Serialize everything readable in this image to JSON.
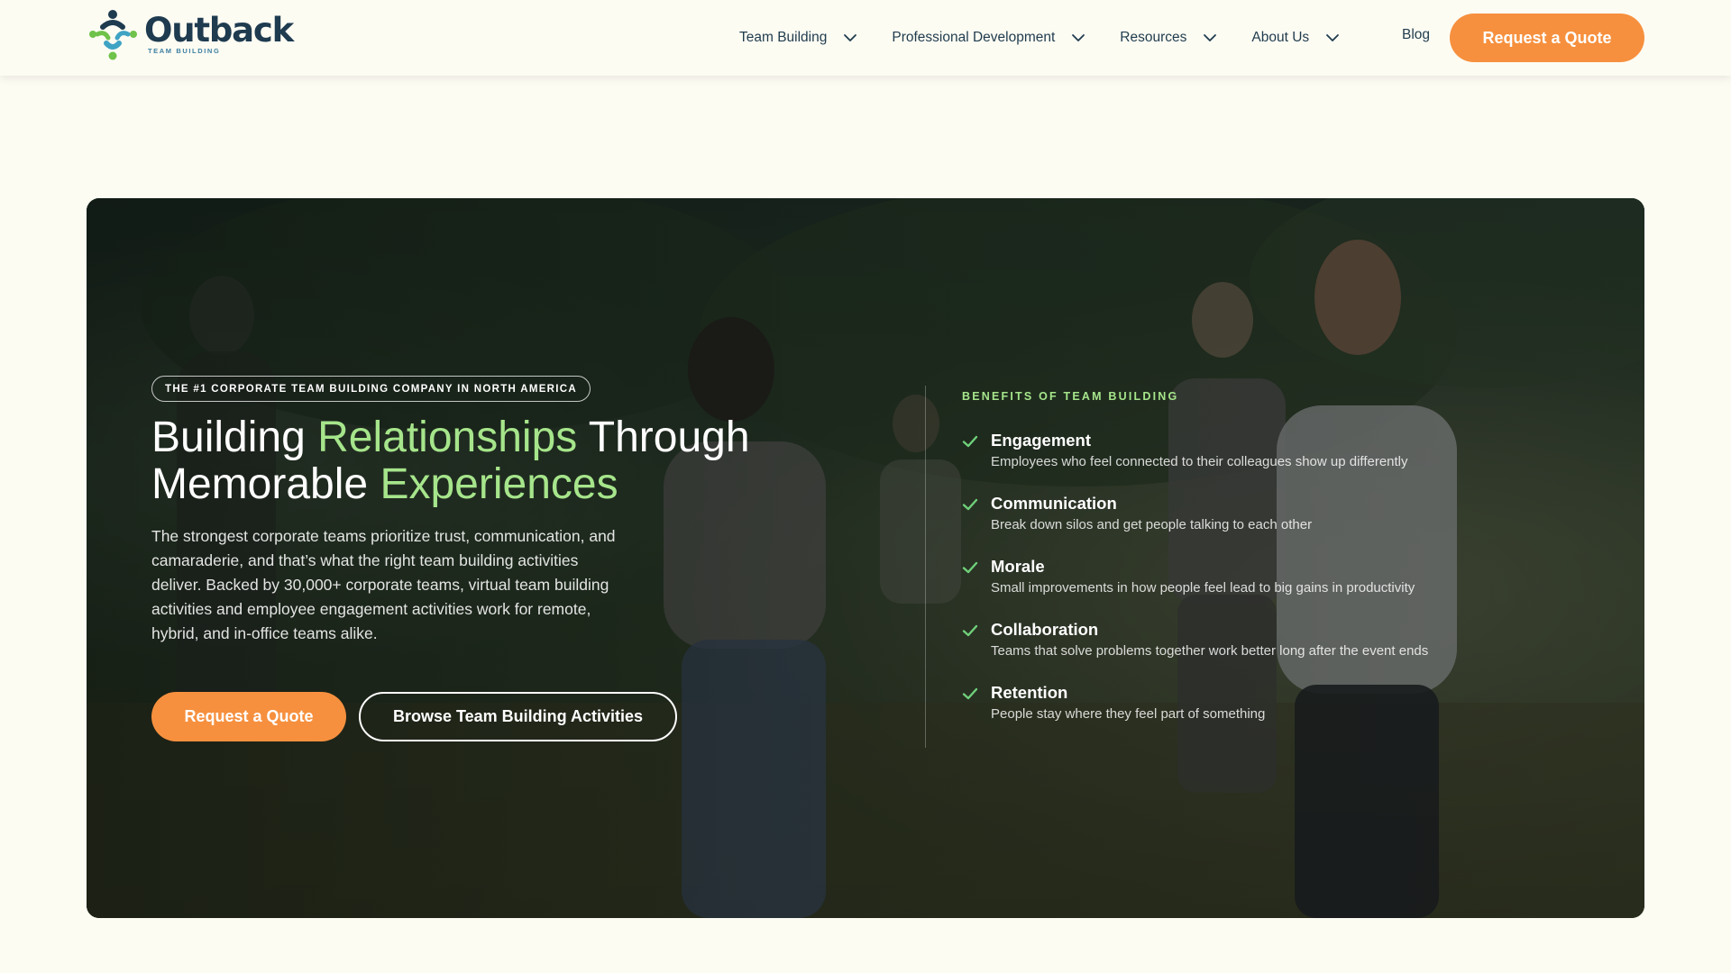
{
  "header": {
    "logo": {
      "word": "Outback",
      "sub": "TEAM BUILDING"
    },
    "nav": [
      {
        "label": "Team Building",
        "has_dropdown": true
      },
      {
        "label": "Professional Development",
        "has_dropdown": true
      },
      {
        "label": "Resources",
        "has_dropdown": true
      },
      {
        "label": "About Us",
        "has_dropdown": true
      }
    ],
    "blog_label": "Blog",
    "cta_label": "Request a Quote"
  },
  "hero": {
    "tagline": "THE #1 CORPORATE TEAM BUILDING COMPANY IN NORTH AMERICA",
    "title": {
      "part1": "Building ",
      "highlight1": "Relationships",
      "part2": " Through Memorable ",
      "highlight2": "Experiences"
    },
    "description": "The strongest corporate teams prioritize trust, communication, and camaraderie, and that’s what the right team building activities deliver. Backed by 30,000+ corporate teams, virtual team building activities and employee engagement activities work for remote, hybrid, and in-office teams alike.",
    "primary_button": "Request a Quote",
    "secondary_button": "Browse Team Building Activities"
  },
  "benefits": {
    "heading": "BENEFITS OF TEAM BUILDING",
    "items": [
      {
        "title": "Engagement",
        "description": "Employees who feel connected to their colleagues show up differently"
      },
      {
        "title": "Communication",
        "description": "Break down silos and get people talking to each other"
      },
      {
        "title": "Morale",
        "description": "Small improvements in how people feel lead to big gains in productivity"
      },
      {
        "title": "Collaboration",
        "description": "Teams that solve problems together work better long after the event ends"
      },
      {
        "title": "Retention",
        "description": "People stay where they feel part of something"
      }
    ]
  },
  "colors": {
    "page_background": "#fdfcf3",
    "brand_navy": "#1e3b4f",
    "accent_orange": "#f6903e",
    "highlight_green": "#a6e58b",
    "check_green": "#6fd07a"
  },
  "icons": {
    "logo": "outback-logo-icon",
    "nav_dropdown": "chevron-down-icon",
    "benefit_bullet": "check-icon"
  }
}
